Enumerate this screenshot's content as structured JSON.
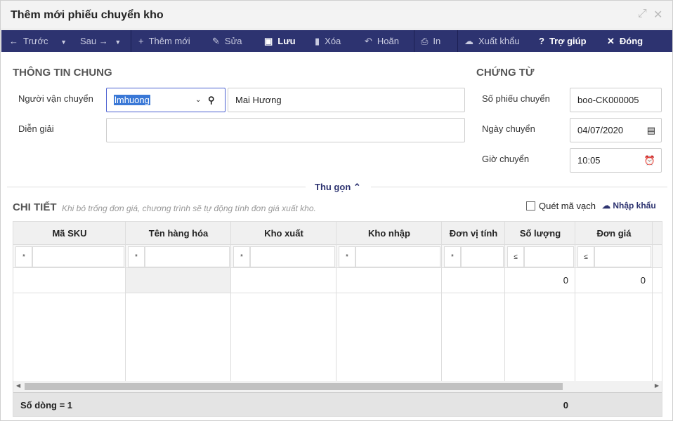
{
  "window": {
    "title": "Thêm mới phiếu chuyển kho"
  },
  "toolbar": {
    "prev": "Trước",
    "next": "Sau",
    "add": "Thêm mới",
    "edit": "Sửa",
    "save": "Lưu",
    "delete": "Xóa",
    "undo": "Hoãn",
    "print": "In",
    "export": "Xuất khẩu",
    "help": "Trợ giúp",
    "close": "Đóng"
  },
  "general": {
    "title": "THÔNG TIN CHUNG",
    "carrier_label": "Người vận chuyển",
    "carrier_code": "lmhuong",
    "carrier_name": "Mai Hương",
    "desc_label": "Diễn giải",
    "desc_value": ""
  },
  "voucher": {
    "title": "CHỨNG TỪ",
    "no_label": "Số phiếu chuyển",
    "no_value": "boo-CK000005",
    "date_label": "Ngày chuyển",
    "date_value": "04/07/2020",
    "time_label": "Giờ chuyển",
    "time_value": "10:05"
  },
  "collapse_label": "Thu gọn",
  "detail": {
    "title": "CHI TIẾT",
    "hint": "Khi bỏ trống đơn giá, chương trình sẽ tự động tính đơn giá xuất kho.",
    "barcode_label": "Quét mã vạch",
    "import_label": "Nhập khẩu"
  },
  "grid": {
    "columns": [
      "Mã SKU",
      "Tên hàng hóa",
      "Kho xuất",
      "Kho nhập",
      "Đơn vị tính",
      "Số lượng",
      "Đơn giá"
    ],
    "filter_ops": [
      "*",
      "*",
      "*",
      "*",
      "*",
      "≤",
      "≤"
    ],
    "row": [
      "",
      "",
      "",
      "",
      "",
      "0",
      "0"
    ],
    "footer_count": "Số dòng = 1",
    "footer_qty": "0"
  }
}
